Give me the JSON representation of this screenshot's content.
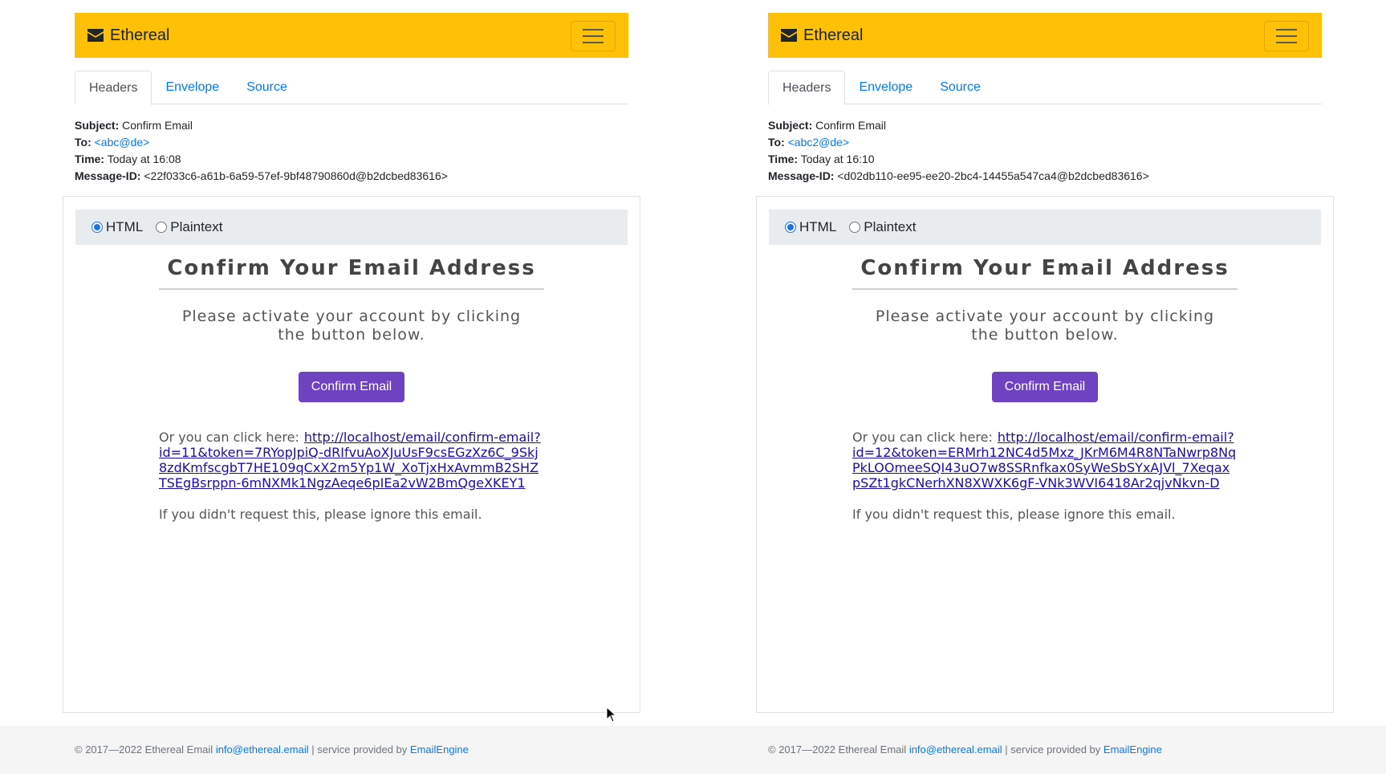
{
  "brand": {
    "name": "Ethereal",
    "accent": "#ffc107"
  },
  "tabs": [
    "Headers",
    "Envelope",
    "Source"
  ],
  "labels": {
    "subject": "Subject:",
    "to": "To:",
    "time": "Time:",
    "message_id": "Message-ID:"
  },
  "view_switch": {
    "html": "HTML",
    "plaintext": "Plaintext",
    "selected": "HTML"
  },
  "messages": [
    {
      "subject": "Confirm Email",
      "to": "<abc@de>",
      "time": "Today at 16:08",
      "message_id": "<22f033c6-a61b-6a59-57ef-9bf48790860d@b2dcbed83616>",
      "body": {
        "heading": "Confirm Your Email Address",
        "activate_text": "Please activate your account by clicking the button below.",
        "button": "Confirm Email",
        "or_text": "Or you can click here:",
        "link": "http://localhost/email/confirm-email?id=11&token=7RYopJpiQ-dRIfvuAoXJuUsF9csEGzXz6C_9Skj8zdKmfscgbT7HE109qCxX2m5Yp1W_XoTjxHxAvmmB2SHZTSEgBsrppn-6mNXMk1NgzAeqe6pIEa2vW2BmQgeXKEY1",
        "ignore_text": "If you didn't request this, please ignore this email."
      }
    },
    {
      "subject": "Confirm Email",
      "to": "<abc2@de>",
      "time": "Today at 16:10",
      "message_id": "<d02db110-ee95-ee20-2bc4-14455a547ca4@b2dcbed83616>",
      "body": {
        "heading": "Confirm Your Email Address",
        "activate_text": "Please activate your account by clicking the button below.",
        "button": "Confirm Email",
        "or_text": "Or you can click here:",
        "link": "http://localhost/email/confirm-email?id=12&token=ERMrh12NC4d5Mxz_JKrM6M4R8NTaNwrp8NqPkLOOmeeSQI43uO7w8SSRnfkax0SyWeSbSYxAJVl_7XeqaxpSZt1gkCNerhXN8XWXK6gF-VNk3WVI6418Ar2qjvNkvn-D",
        "ignore_text": "If you didn't request this, please ignore this email."
      }
    }
  ],
  "footer": {
    "copyright": "© 2017—2022 Ethereal Email",
    "email": "info@ethereal.email",
    "separator": "|",
    "service_text": "service provided by",
    "provider": "EmailEngine"
  },
  "colors": {
    "confirm_button": "#6f42c1",
    "link": "#007bff"
  }
}
